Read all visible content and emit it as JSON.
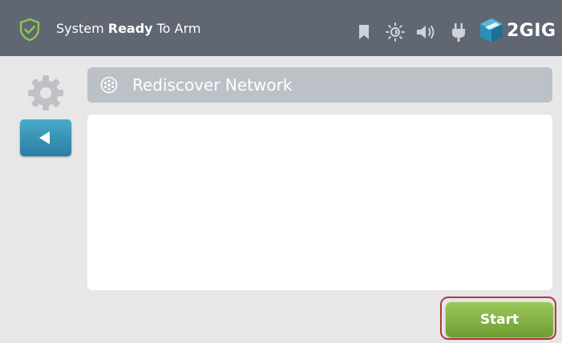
{
  "status_bar": {
    "status_prefix": "System ",
    "status_bold": "Ready",
    "status_suffix": " To Arm",
    "brand": "2GIG",
    "icons": [
      "shield-check-icon",
      "bookmark-icon",
      "brightness-icon",
      "volume-icon",
      "power-plug-icon",
      "brand-logo-icon"
    ]
  },
  "sidebar": {
    "icons": [
      "gear-icon",
      "back-arrow-icon"
    ]
  },
  "panel": {
    "title": "Rediscover Network",
    "icon": "network-icon"
  },
  "actions": {
    "start_label": "Start"
  },
  "colors": {
    "topbar": "#606772",
    "background": "#e7e7e7",
    "panel_header": "#bcc1c8",
    "back_button": "#3a93b8",
    "start_button": "#86b548",
    "highlight": "#b8363d",
    "shield_green": "#7ec04a"
  }
}
